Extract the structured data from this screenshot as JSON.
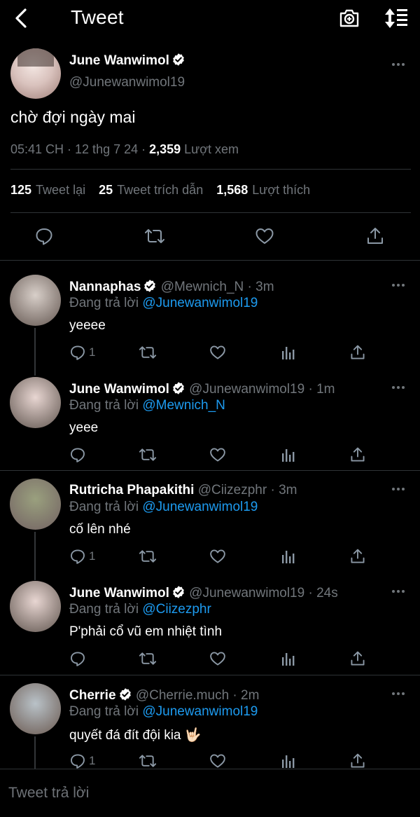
{
  "header": {
    "title": "Tweet"
  },
  "tweet": {
    "author_name": "June Wanwimol",
    "author_handle": "@Junewanwimol19",
    "text": "chờ đợi ngày mai",
    "time": "05:41 CH · 12 thg 7 24 · ",
    "views": "2,359",
    "views_label": " Lượt xem",
    "retweets": "125",
    "retweets_label": "Tweet lại",
    "quotes": "25",
    "quotes_label": "Tweet trích dẫn",
    "likes": "1,568",
    "likes_label": "Lượt thích"
  },
  "replies": [
    {
      "name": "Nannaphas",
      "handle_time": "@Mewnich_N · 3m",
      "replying_prefix": "Đang trả lời ",
      "replying_to": "@Junewanwimol19",
      "text": "yeeee",
      "reply_count": "1",
      "avatar_color": "#d8cfc9"
    },
    {
      "name": "June Wanwimol",
      "handle_time": "@Junewanwimol19 · 1m",
      "replying_prefix": "Đang trả lời ",
      "replying_to": "@Mewnich_N",
      "text": "yeee",
      "reply_count": "",
      "avatar_color": "#e8d6d2"
    },
    {
      "name": "Rutricha Phapakithi",
      "handle_time": "@Ciizezphr · 3m",
      "replying_prefix": "Đang trả lời ",
      "replying_to": "@Junewanwimol19",
      "text": "cố lên nhé",
      "reply_count": "1",
      "avatar_color": "#9aa07e"
    },
    {
      "name": "June Wanwimol",
      "handle_time": "@Junewanwimol19 · 24s",
      "replying_prefix": "Đang trả lời ",
      "replying_to": "@Ciizezphr",
      "text": "P'phải cổ vũ em nhiệt tình",
      "reply_count": "",
      "avatar_color": "#e8d6d2"
    },
    {
      "name": "Cherrie",
      "handle_time": "@Cherrie.much · 2m",
      "replying_prefix": "Đang trả lời ",
      "replying_to": "@Junewanwimol19",
      "text": "quyết đá đít đội kia 🤟🏻",
      "reply_count": "1",
      "avatar_color": "#b9c2c8"
    }
  ],
  "composer": {
    "placeholder": "Tweet trả lời"
  },
  "colors": {
    "accent": "#1d9bf0",
    "muted": "#71767b",
    "background": "#000000"
  }
}
